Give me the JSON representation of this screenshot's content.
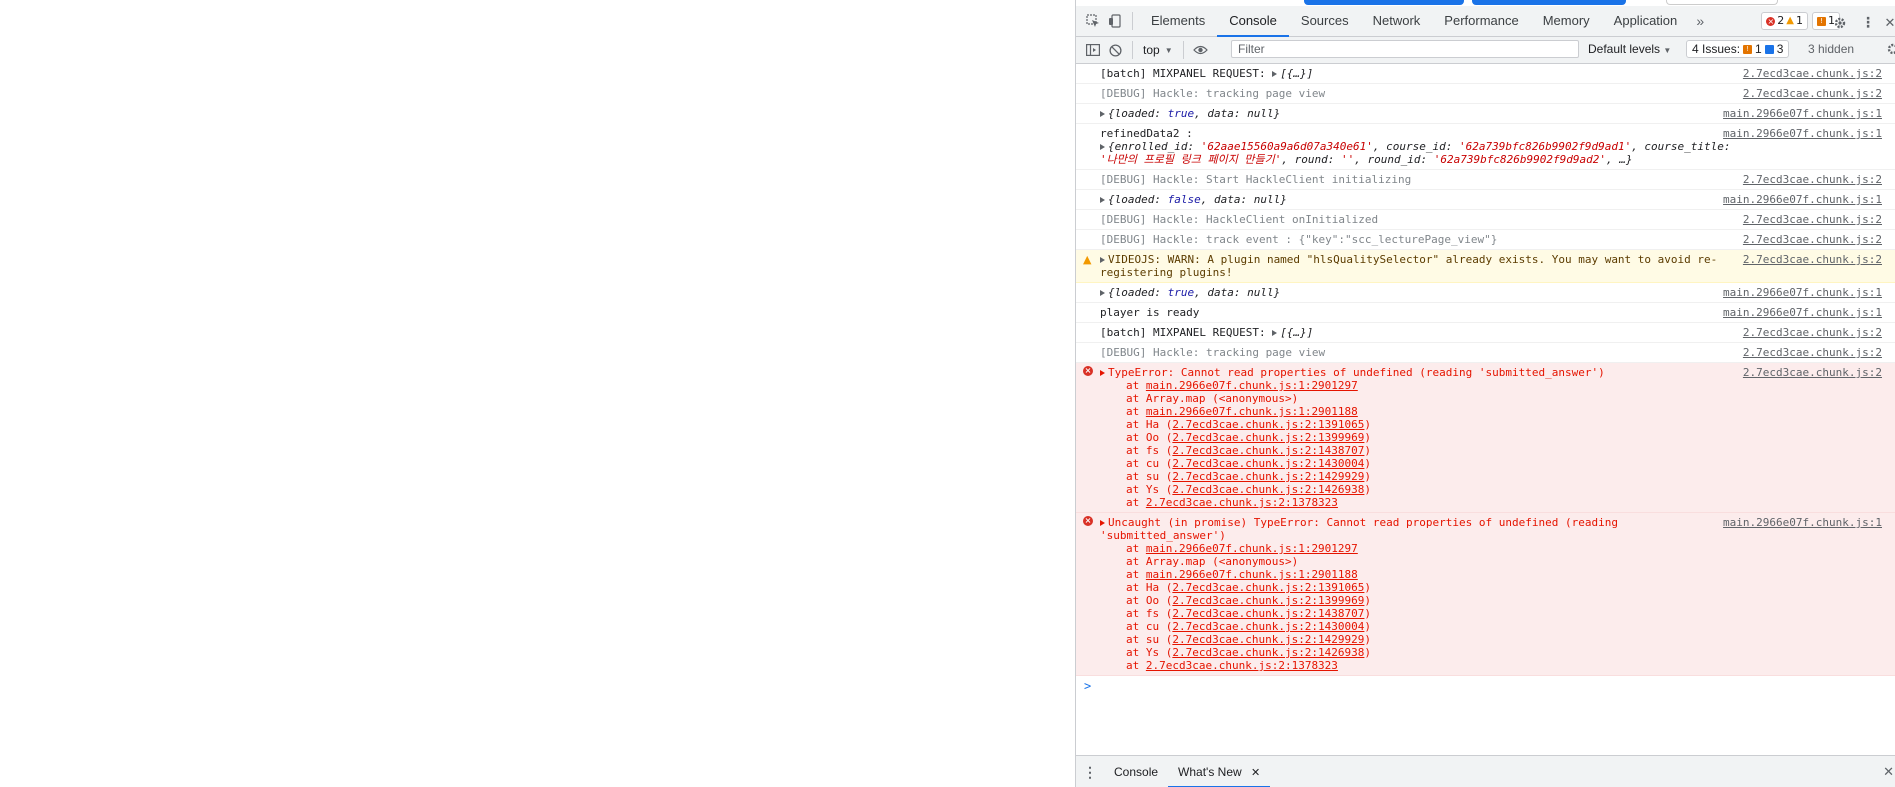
{
  "colors": {
    "accent": "#1a73e8",
    "error": "#e51400",
    "warn_bg": "#fffbe5",
    "error_bg": "#fcecec"
  },
  "tabs": [
    "Elements",
    "Console",
    "Sources",
    "Network",
    "Performance",
    "Memory",
    "Application"
  ],
  "active_tab": "Console",
  "more_tabs_icon": "chevron-double-right-icon",
  "counters": {
    "errors": "2",
    "warnings": "1",
    "issues": "1"
  },
  "toolbar": {
    "context": "top",
    "filter_placeholder": "Filter",
    "levels": "Default levels",
    "issues_label": "4 Issues:",
    "issues_warn": "1",
    "issues_info": "3",
    "hidden": "3 hidden"
  },
  "logs": [
    {
      "kind": "normal",
      "text": "[batch] MIXPANEL REQUEST: ",
      "obj": "[{…}]",
      "src": "2.7ecd3cae.chunk.js:2"
    },
    {
      "kind": "dbg",
      "text": "[DEBUG] Hackle: tracking page view",
      "src": "2.7ecd3cae.chunk.js:2"
    },
    {
      "kind": "obj",
      "pre": "{loaded: ",
      "kw": "true",
      "post": ", data: null}",
      "src": "main.2966e07f.chunk.js:1"
    },
    {
      "kind": "refined",
      "label": "refinedData2 :",
      "p1": "{enrolled_id: ",
      "s1": "'62aae15560a9a6d07a340e61'",
      "p2": ", course_id: ",
      "s2": "'62a739bfc826b9902f9d9ad1'",
      "p3": ", course_title: ",
      "s3": "'나만의 프로필 링크 페이지 만들기'",
      "p4": ", round: ",
      "s4": "''",
      "p5": ", round_id: ",
      "s5": "'62a739bfc826b9902f9d9ad2'",
      "p6": ", …}",
      "src": "main.2966e07f.chunk.js:1"
    },
    {
      "kind": "dbg",
      "text": "[DEBUG] Hackle: Start HackleClient initializing",
      "src": "2.7ecd3cae.chunk.js:2"
    },
    {
      "kind": "obj",
      "pre": "{loaded: ",
      "kw": "false",
      "post": ", data: null}",
      "src": "main.2966e07f.chunk.js:1"
    },
    {
      "kind": "dbg",
      "text": "[DEBUG] Hackle: HackleClient onInitialized",
      "src": "2.7ecd3cae.chunk.js:2"
    },
    {
      "kind": "dbg",
      "text": "[DEBUG] Hackle: track event : {\"key\":\"scc_lecturePage_view\"}",
      "src": "2.7ecd3cae.chunk.js:2"
    },
    {
      "kind": "warn",
      "text": "VIDEOJS: WARN: A plugin named \"hlsQualitySelector\" already exists. You may want to avoid re-registering plugins!",
      "src": "2.7ecd3cae.chunk.js:2"
    },
    {
      "kind": "obj",
      "pre": "{loaded: ",
      "kw": "true",
      "post": ", data: null}",
      "src": "main.2966e07f.chunk.js:1"
    },
    {
      "kind": "normal2",
      "text": "player is ready",
      "src": "main.2966e07f.chunk.js:1"
    },
    {
      "kind": "normal",
      "text": "[batch] MIXPANEL REQUEST: ",
      "obj": "[{…}]",
      "src": "2.7ecd3cae.chunk.js:2"
    },
    {
      "kind": "dbg",
      "text": "[DEBUG] Hackle: tracking page view",
      "src": "2.7ecd3cae.chunk.js:2"
    }
  ],
  "errors": [
    {
      "head": "TypeError: Cannot read properties of undefined (reading 'submitted_answer')",
      "src": "2.7ecd3cae.chunk.js:2",
      "stack": [
        {
          "pre": "at ",
          "link": "main.2966e07f.chunk.js:1:2901297",
          "paren": false
        },
        {
          "pre": "at Array.map (<anonymous>)",
          "link": "",
          "paren": false
        },
        {
          "pre": "at ",
          "link": "main.2966e07f.chunk.js:1:2901188",
          "paren": false
        },
        {
          "pre": "at Ha (",
          "link": "2.7ecd3cae.chunk.js:2:1391065",
          "paren": true
        },
        {
          "pre": "at Oo (",
          "link": "2.7ecd3cae.chunk.js:2:1399969",
          "paren": true
        },
        {
          "pre": "at fs (",
          "link": "2.7ecd3cae.chunk.js:2:1438707",
          "paren": true
        },
        {
          "pre": "at cu (",
          "link": "2.7ecd3cae.chunk.js:2:1430004",
          "paren": true
        },
        {
          "pre": "at su (",
          "link": "2.7ecd3cae.chunk.js:2:1429929",
          "paren": true
        },
        {
          "pre": "at Ys (",
          "link": "2.7ecd3cae.chunk.js:2:1426938",
          "paren": true
        },
        {
          "pre": "at ",
          "link": "2.7ecd3cae.chunk.js:2:1378323",
          "paren": false
        }
      ]
    },
    {
      "head": "Uncaught (in promise) TypeError: Cannot read properties of undefined (reading 'submitted_answer')",
      "src": "main.2966e07f.chunk.js:1",
      "stack": [
        {
          "pre": "at ",
          "link": "main.2966e07f.chunk.js:1:2901297",
          "paren": false
        },
        {
          "pre": "at Array.map (<anonymous>)",
          "link": "",
          "paren": false
        },
        {
          "pre": "at ",
          "link": "main.2966e07f.chunk.js:1:2901188",
          "paren": false
        },
        {
          "pre": "at Ha (",
          "link": "2.7ecd3cae.chunk.js:2:1391065",
          "paren": true
        },
        {
          "pre": "at Oo (",
          "link": "2.7ecd3cae.chunk.js:2:1399969",
          "paren": true
        },
        {
          "pre": "at fs (",
          "link": "2.7ecd3cae.chunk.js:2:1438707",
          "paren": true
        },
        {
          "pre": "at cu (",
          "link": "2.7ecd3cae.chunk.js:2:1430004",
          "paren": true
        },
        {
          "pre": "at su (",
          "link": "2.7ecd3cae.chunk.js:2:1429929",
          "paren": true
        },
        {
          "pre": "at Ys (",
          "link": "2.7ecd3cae.chunk.js:2:1426938",
          "paren": true
        },
        {
          "pre": "at ",
          "link": "2.7ecd3cae.chunk.js:2:1378323",
          "paren": false
        }
      ]
    }
  ],
  "prompt_symbol": ">",
  "drawer": {
    "tabs": [
      "Console",
      "What's New"
    ],
    "active": "What's New"
  }
}
